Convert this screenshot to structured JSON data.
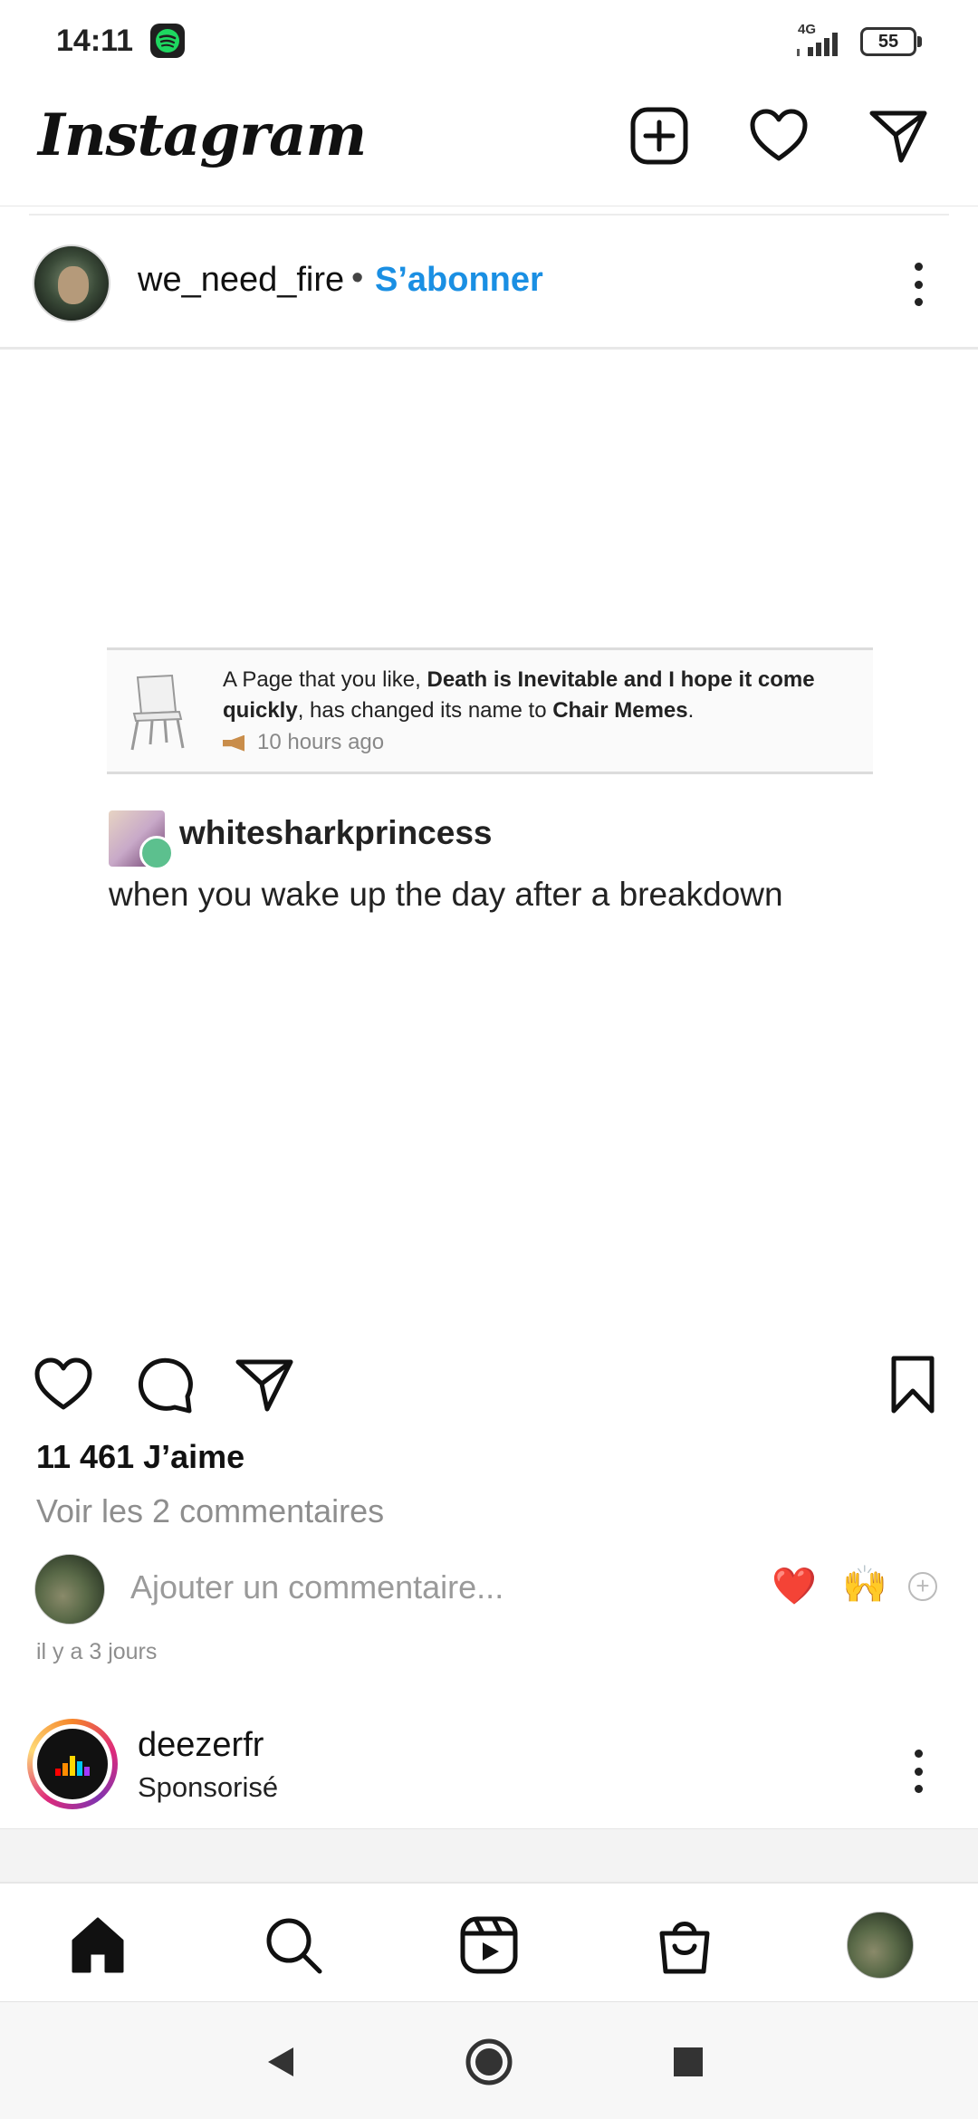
{
  "status_bar": {
    "time": "14:11",
    "network": "4G",
    "battery": "55",
    "notification_icon": "spotify-icon"
  },
  "header": {
    "logo_text": "Instagram",
    "icons": [
      "new-post-icon",
      "heart-icon",
      "direct-message-icon"
    ]
  },
  "post": {
    "username": "we_need_fire",
    "separator": "•",
    "follow_label": "S’abonner",
    "image": {
      "fb_text_1": "A Page that you like, ",
      "fb_bold_1": "Death is Inevitable and I hope it come quickly",
      "fb_text_2": ", has changed its name to ",
      "fb_bold_2": "Chair Memes",
      "fb_text_3": ".",
      "fb_time": "10 hours ago",
      "tumblr_user": "whitesharkprincess",
      "tumblr_caption": "when you wake up the day after a breakdown"
    },
    "likes": "11 461 J’aime",
    "view_comments": "Voir les 2 commentaires",
    "comment_placeholder": "Ajouter un commentaire...",
    "quick_reactions": [
      "❤️",
      "🙌"
    ],
    "add_reaction": "+",
    "time_ago": "il y a 3 jours"
  },
  "sponsored": {
    "name": "deezerfr",
    "label": "Sponsorisé"
  },
  "bottom_nav": [
    "home-icon",
    "search-icon",
    "reels-icon",
    "shop-icon",
    "profile-avatar"
  ],
  "colors": {
    "accent": "#1a8fe3",
    "heart_red": "#e0142b",
    "muted_text": "#8e8e8e"
  }
}
